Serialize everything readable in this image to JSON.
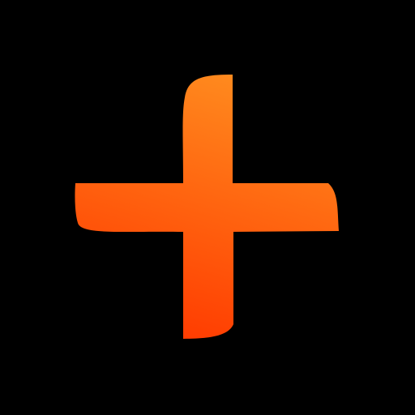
{
  "icon": {
    "name": "plus-icon",
    "background_color": "#000000",
    "gradient_start": "#FF8A1E",
    "gradient_end": "#FF3A00"
  }
}
